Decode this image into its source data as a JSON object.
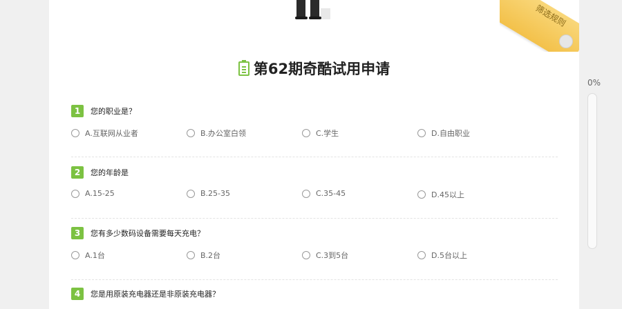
{
  "corner": {
    "label": "筛选规则"
  },
  "title": "第62期奇酷试用申请",
  "questions": [
    {
      "num": "1",
      "text": "您的职业是？",
      "options": [
        "A.互联网从业者",
        "B.办公室白领",
        "C.学生",
        "D.自由职业"
      ]
    },
    {
      "num": "2",
      "text": "您的年龄是",
      "options": [
        "A.15-25",
        "B.25-35",
        "C.35-45",
        "D.45以上"
      ]
    },
    {
      "num": "3",
      "text": "您有多少数码设备需要每天充电？",
      "options": [
        "A.1台",
        "B.2台",
        "C.3到5台",
        "D.5台以上"
      ]
    },
    {
      "num": "4",
      "text": "您是用原装充电器还是非原装充电器？",
      "options": []
    }
  ],
  "progress": {
    "label": "0%",
    "value": 0
  }
}
